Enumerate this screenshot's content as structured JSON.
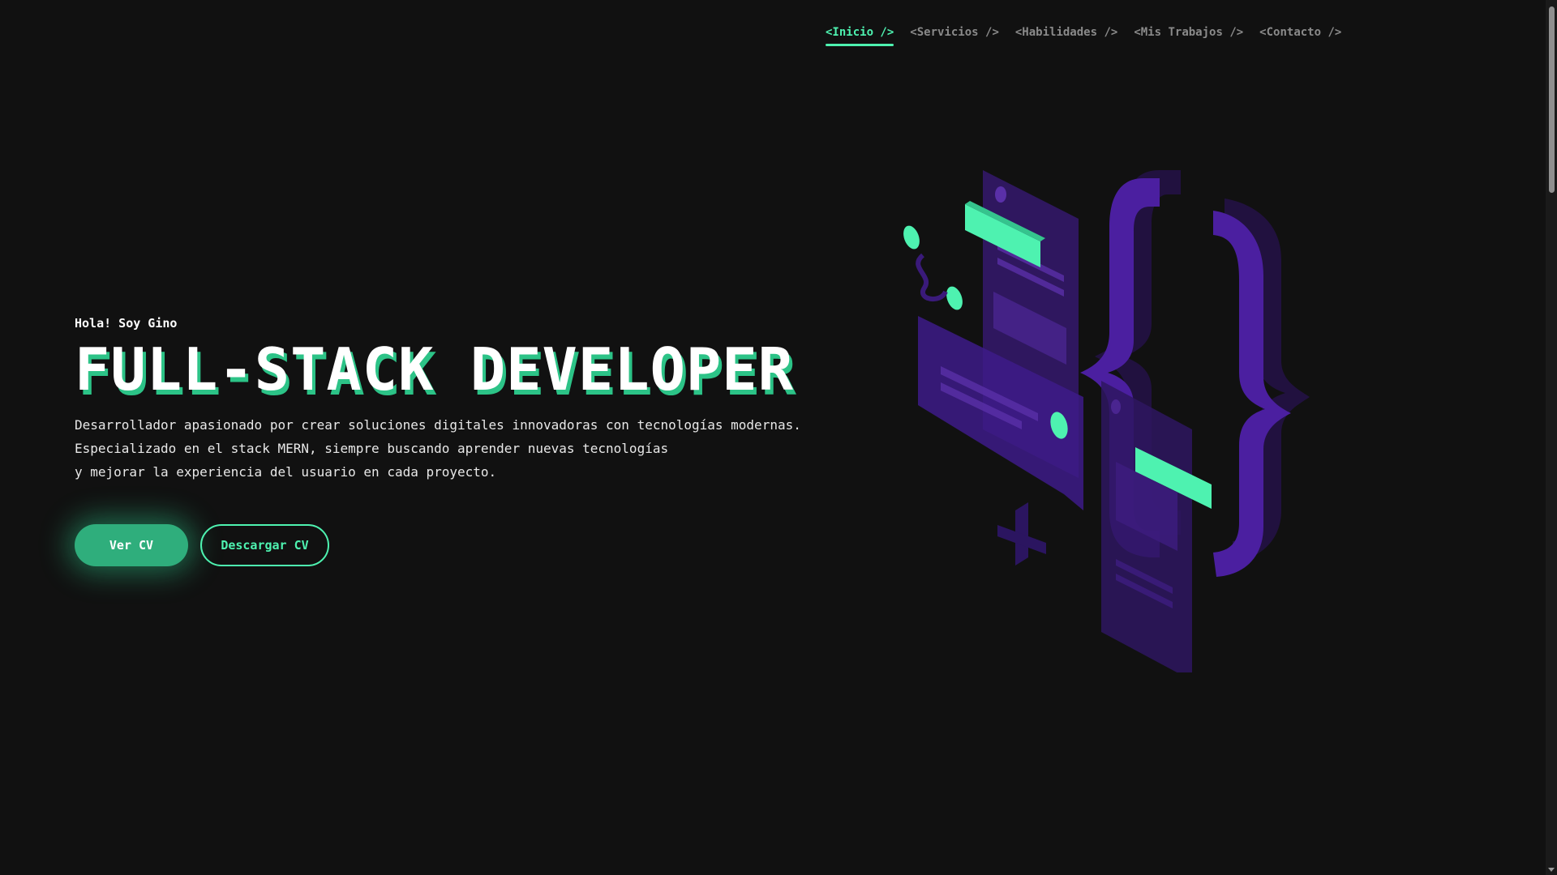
{
  "nav": {
    "items": [
      {
        "label": "<Inicio />",
        "active": true
      },
      {
        "label": "<Servicios />",
        "active": false
      },
      {
        "label": "<Habilidades />",
        "active": false
      },
      {
        "label": "<Mis Trabajos />",
        "active": false
      },
      {
        "label": "<Contacto />",
        "active": false
      }
    ]
  },
  "hero": {
    "greeting": "Hola! Soy Gino",
    "title": "FULL-STACK DEVELOPER",
    "description": [
      "Desarrollador apasionado por crear soluciones digitales innovadoras con tecnologías modernas.",
      "Especializado en el stack MERN, siempre buscando aprender nuevas tecnologías",
      "y mejorar la experiencia del usuario en cada proyecto."
    ],
    "buttons": {
      "primary": "Ver CV",
      "secondary": "Descargar CV"
    }
  },
  "illustration": {
    "icon": "code-braces-illustration"
  },
  "colors": {
    "background": "#111111",
    "accent": "#4ef2b0",
    "accent_dark": "#2fae7c",
    "purple": "#4b1fa0",
    "nav_inactive": "#8a8a8a"
  }
}
